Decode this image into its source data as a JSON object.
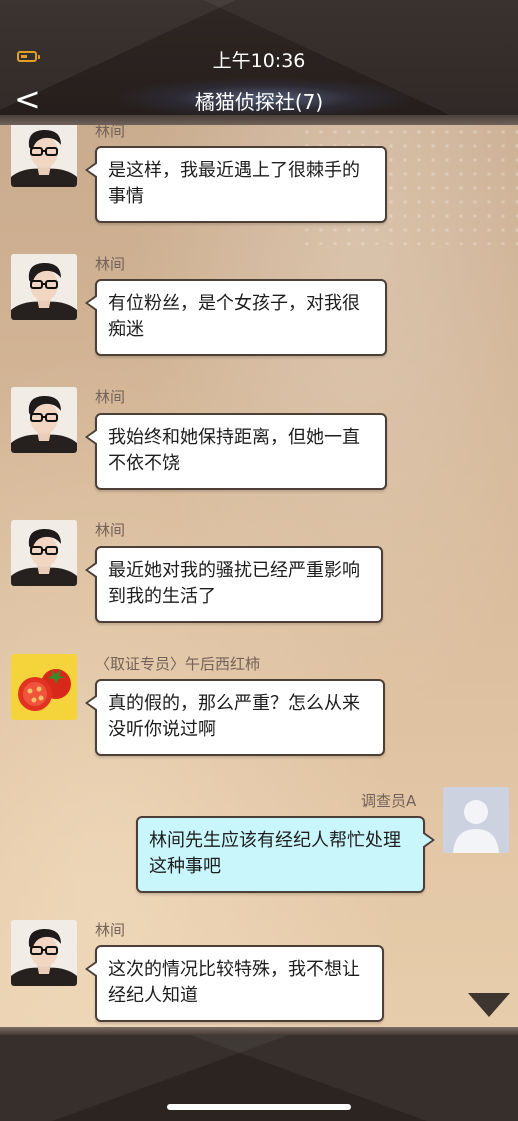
{
  "status_bar": {
    "time": "上午10:36",
    "battery_icon": "battery-low-icon",
    "battery_color": "#e0a028"
  },
  "header": {
    "back_label": "<",
    "title": "橘猫侦探社(7)"
  },
  "messages": [
    {
      "side": "left",
      "sender": "林间",
      "avatar": "man-with-glasses-avatar",
      "lines": [
        "是这样，我最近遇上了很棘手的",
        "事情"
      ]
    },
    {
      "side": "left",
      "sender": "林间",
      "avatar": "man-with-glasses-avatar",
      "lines": [
        "有位粉丝，是个女孩子，对我很",
        "痴迷"
      ]
    },
    {
      "side": "left",
      "sender": "林间",
      "avatar": "man-with-glasses-avatar",
      "lines": [
        "我始终和她保持距离，但她一直",
        "不依不饶"
      ]
    },
    {
      "side": "left",
      "sender": "林间",
      "avatar": "man-with-glasses-avatar",
      "lines": [
        "最近她对我的骚扰已经严重影响",
        "到我的生活了"
      ]
    },
    {
      "side": "left",
      "sender": "〈取证专员〉午后西红柿",
      "avatar": "tomato-avatar",
      "lines": [
        "真的假的，那么严重？怎么从来",
        "没听你说过啊"
      ]
    },
    {
      "side": "right",
      "sender": "调查员A",
      "avatar": "default-user-avatar",
      "lines": [
        "林间先生应该有经纪人帮忙处理",
        "这种事吧"
      ]
    },
    {
      "side": "left",
      "sender": "林间",
      "avatar": "man-with-glasses-avatar",
      "lines": [
        "这次的情况比较特殊，我不想让",
        "经纪人知道"
      ]
    }
  ],
  "colors": {
    "left_bubble": "#ffffff",
    "right_bubble": "#c9f6fb",
    "bubble_border": "#4b3f38",
    "sender_name": "#736257"
  },
  "more_icon": "triangle-down-icon"
}
